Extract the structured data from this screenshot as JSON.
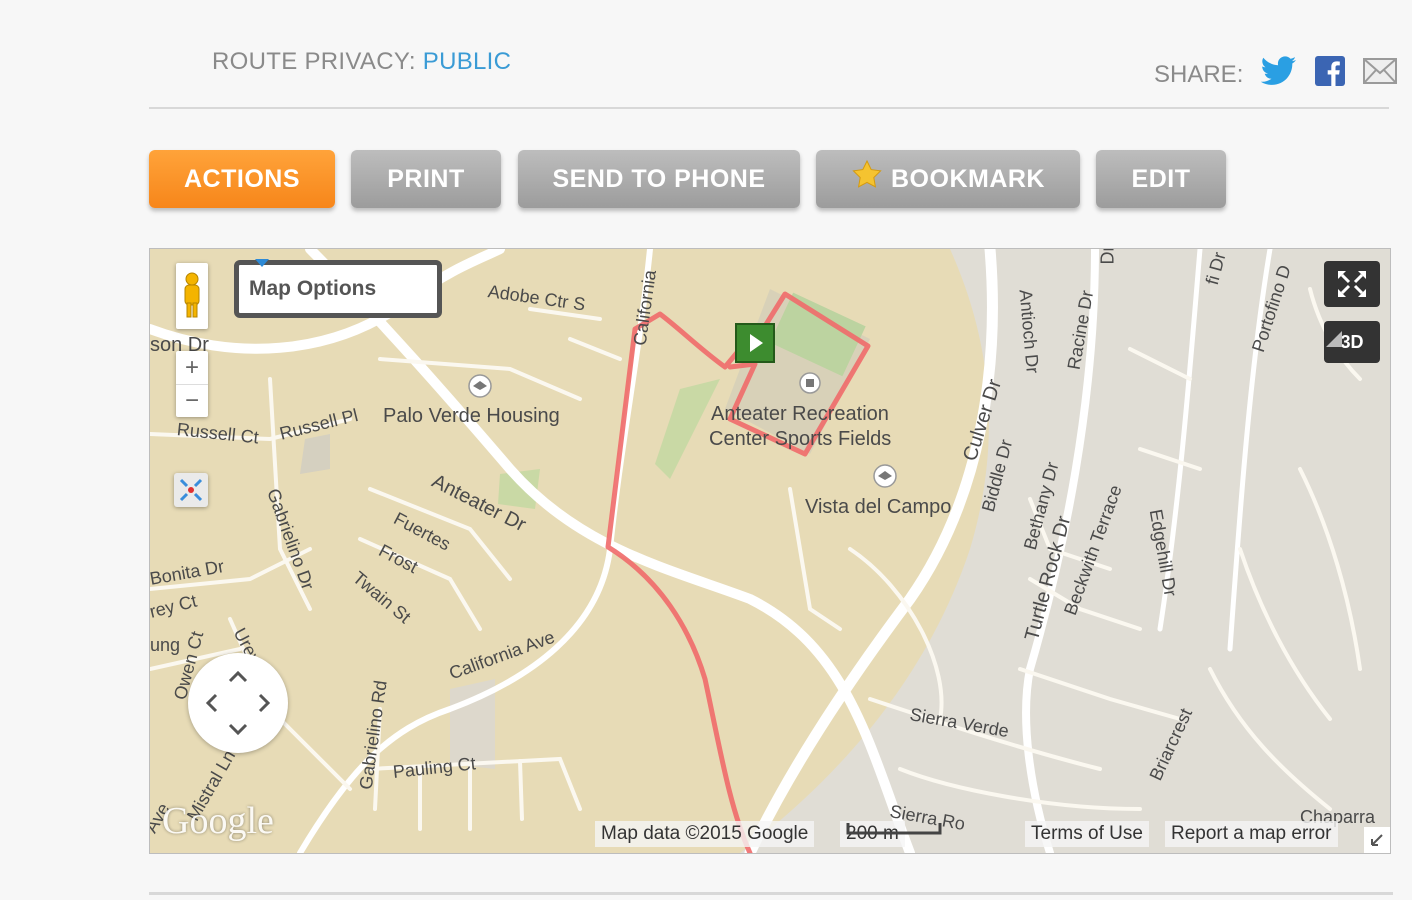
{
  "header": {
    "privacy_label": "ROUTE PRIVACY:",
    "privacy_value": "PUBLIC",
    "share_label": "SHARE:"
  },
  "actions": {
    "actions_label": "ACTIONS",
    "print_label": "PRINT",
    "send_label": "SEND TO PHONE",
    "bookmark_label": "BOOKMARK",
    "edit_label": "EDIT"
  },
  "map": {
    "options_label": "Map Options",
    "zoom_in": "+",
    "zoom_out": "−",
    "three_d_label": "3D",
    "places": {
      "palo_verde": "Palo Verde Housing",
      "arc_line1": "Anteater Recreation",
      "arc_line2": "Center Sports Fields",
      "vista": "Vista del Campo"
    },
    "streets": {
      "adobe": "Adobe Ctr S",
      "california_top": "California",
      "son_dr": "son Dr",
      "russell_ct": "Russell Ct",
      "russell_pl": "Russell Pl",
      "anteater": "Anteater Dr",
      "gabrielino": "Gabrielino Dr",
      "fuertes": "Fuertes",
      "frost": "Frost",
      "twain": "Twain St",
      "bonita": "Bonita Dr",
      "rey_ct": "rey Ct",
      "ung": "ung",
      "owen": "Owen Ct",
      "urey": "Urey Ct",
      "california_ave": "California Ave",
      "gabrielino_rd": "Gabrielino Rd",
      "paulin": "Pauling Ct",
      "ave": "Ave",
      "mistral": "Mistral Ln",
      "culver": "Culver Dr",
      "antioch": "Antioch Dr",
      "racine": "Racine Dr",
      "dr_top": "Dr",
      "fi_dr": "fi Dr",
      "portofino": "Portofino D",
      "biddle": "Biddle Dr",
      "bethany": "Bethany Dr",
      "turtle": "Turtle Rock Dr",
      "beckwith": "Beckwith Terrace",
      "edgehill": "Edgehill Dr",
      "sierra_verde": "Sierra Verde",
      "briarcrest": "Briarcrest",
      "sierra_bottom": "Sierra Ro",
      "chaparra": "Chaparra"
    },
    "attribution": {
      "google_logo": "Google",
      "map_data": "Map data ©2015 Google",
      "scale": "200 m",
      "terms": "Terms of Use",
      "report": "Report a map error"
    },
    "colors": {
      "route": "#f06a6a",
      "land": "#e7dbb6",
      "residential": "#e0ddd5",
      "road": "#ffffff",
      "field": "#bcd3a0",
      "start_marker": "#3d8c2f"
    }
  }
}
